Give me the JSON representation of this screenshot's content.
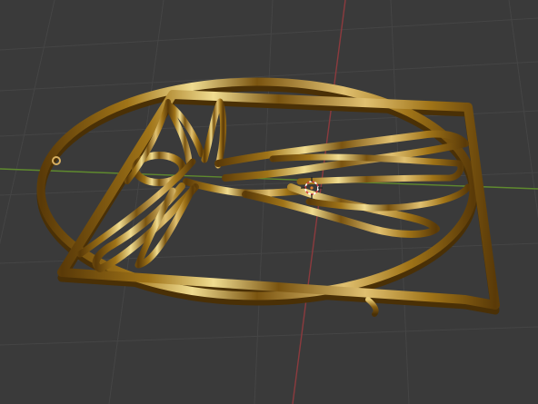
{
  "viewport": {
    "background": "#3a3a3a",
    "grid_color": "#454545",
    "x_axis_color": "#8c3a3e",
    "y_axis_color": "#5f8a2e",
    "object": {
      "material_colors": [
        "#5a3a08",
        "#a07418",
        "#e0c070",
        "#7a5410",
        "#f0dc90"
      ],
      "subject": "vitruvian-man-wireframe"
    },
    "icons": {
      "origin": "origin-icon",
      "cursor": "3d-cursor-icon"
    }
  }
}
